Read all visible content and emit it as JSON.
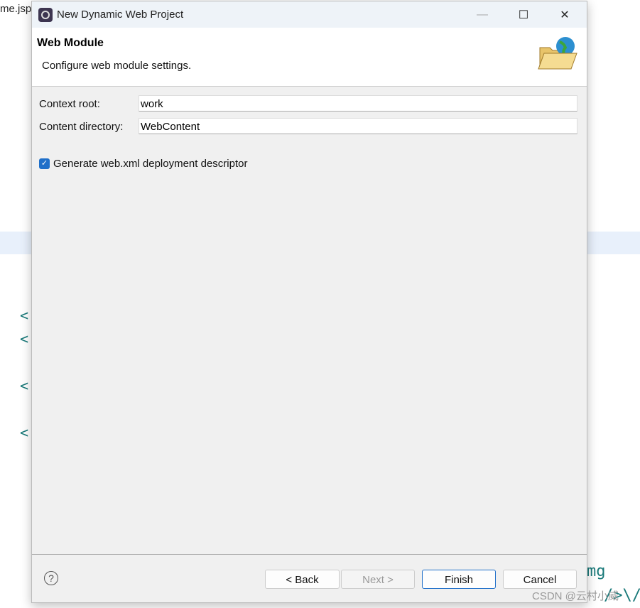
{
  "background": {
    "tab": "me.jsp",
    "code_fragment_1": "mg",
    "code_fragment_2": "/>\\/",
    "watermark": "CSDN @云村小威"
  },
  "dialog": {
    "title": "New Dynamic Web Project",
    "minimize": "—",
    "maximize": "☐",
    "close": "✕",
    "header": {
      "title": "Web Module",
      "subtitle": "Configure web module settings."
    },
    "fields": [
      {
        "label": "Context root:",
        "value": "work"
      },
      {
        "label": "Content directory:",
        "value": "WebContent"
      }
    ],
    "checkbox": {
      "label": "Generate web.xml deployment descriptor",
      "checked": true
    },
    "help": "?",
    "buttons": {
      "back": "< Back",
      "next": "Next >",
      "finish": "Finish",
      "cancel": "Cancel"
    }
  },
  "colors": {
    "accent": "#1f6fc9"
  }
}
